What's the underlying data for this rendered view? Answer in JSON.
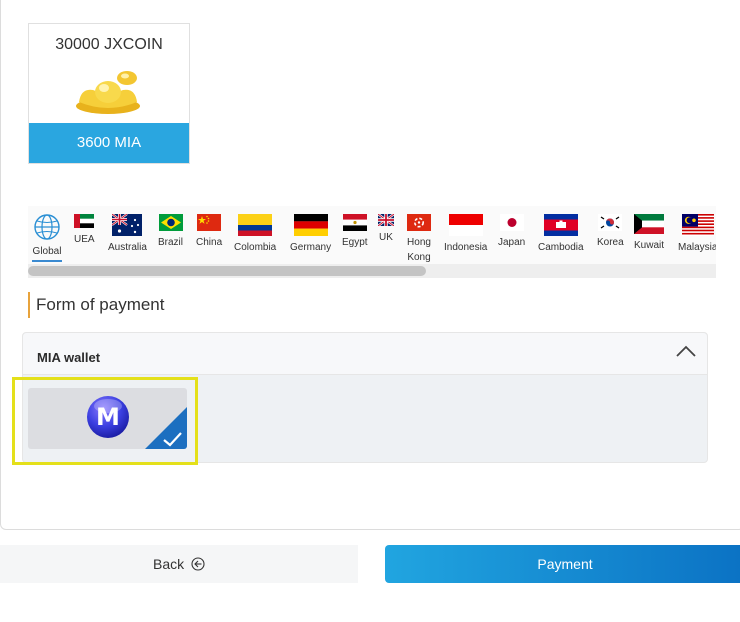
{
  "product": {
    "title": "30000 JXCOIN",
    "price": "3600 MIA",
    "image_icon": "gold-ingot-icon"
  },
  "countries": [
    {
      "label": "Global",
      "icon": "globe-icon",
      "selected": true
    },
    {
      "label": "UEA",
      "icon": "uae-flag-icon"
    },
    {
      "label": "Australia",
      "icon": "australia-flag-icon"
    },
    {
      "label": "Brazil",
      "icon": "brazil-flag-icon"
    },
    {
      "label": "China",
      "icon": "china-flag-icon"
    },
    {
      "label": "Colombia",
      "icon": "colombia-flag-icon"
    },
    {
      "label": "Germany",
      "icon": "germany-flag-icon"
    },
    {
      "label": "Egypt",
      "icon": "egypt-flag-icon"
    },
    {
      "label": "UK",
      "icon": "uk-flag-icon"
    },
    {
      "label": "Hong Kong",
      "icon": "hong-kong-flag-icon"
    },
    {
      "label": "Indonesia",
      "icon": "indonesia-flag-icon"
    },
    {
      "label": "Japan",
      "icon": "japan-flag-icon"
    },
    {
      "label": "Cambodia",
      "icon": "cambodia-flag-icon"
    },
    {
      "label": "Korea",
      "icon": "korea-flag-icon"
    },
    {
      "label": "Kuwait",
      "icon": "kuwait-flag-icon"
    },
    {
      "label": "Malaysia",
      "icon": "malaysia-flag-icon"
    }
  ],
  "payment": {
    "section_title": "Form of payment",
    "wallet_name": "MIA wallet",
    "method_icon": "mia-logo-icon",
    "selected": true
  },
  "buttons": {
    "back": "Back",
    "payment": "Payment"
  },
  "colors": {
    "accent": "#2aa6e0",
    "highlight": "#e4e01a",
    "section_marker": "#e8a33c"
  }
}
